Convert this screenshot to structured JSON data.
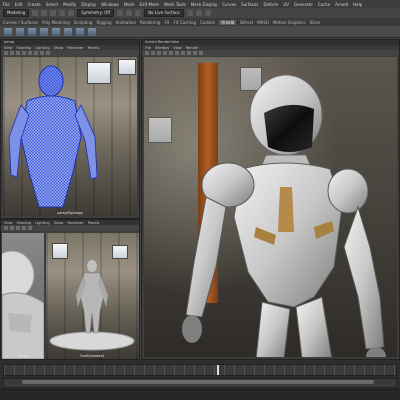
{
  "menubar": {
    "items": [
      "File",
      "Edit",
      "Create",
      "Select",
      "Modify",
      "Display",
      "Windows",
      "Mesh",
      "Edit Mesh",
      "Mesh Tools",
      "Mesh Display",
      "Curves",
      "Surfaces",
      "Deform",
      "UV",
      "Generate",
      "Cache",
      "Arnold",
      "Help"
    ]
  },
  "status": {
    "mode": "Modeling",
    "workspace": "Symmetry: Off",
    "live": "No Live Surface"
  },
  "shelf": {
    "tabs": [
      "Curves / Surfaces",
      "Poly Modeling",
      "Sculpting",
      "Rigging",
      "Animation",
      "Rendering",
      "FX",
      "FX Caching",
      "Custom",
      "Arnold",
      "Bifrost",
      "MASH",
      "Motion Graphics",
      "XGen"
    ],
    "active": "Arnold"
  },
  "panels": {
    "top_left": {
      "title": "persp",
      "menu": [
        "View",
        "Shading",
        "Lighting",
        "Show",
        "Renderer",
        "Panels"
      ],
      "cam": "persp/Topology"
    },
    "bottom_tabs": {
      "menu": [
        "View",
        "Shading",
        "Lighting",
        "Show",
        "Renderer",
        "Panels"
      ]
    },
    "bottom_left": {
      "cam": "persp"
    },
    "bottom_mid": {
      "cam": "front/camera1"
    },
    "main": {
      "title": "Arnold RenderView",
      "menu": [
        "File",
        "Window",
        "View",
        "Render"
      ],
      "cam": "persp"
    }
  },
  "timeline": {
    "current_frame": "120"
  }
}
